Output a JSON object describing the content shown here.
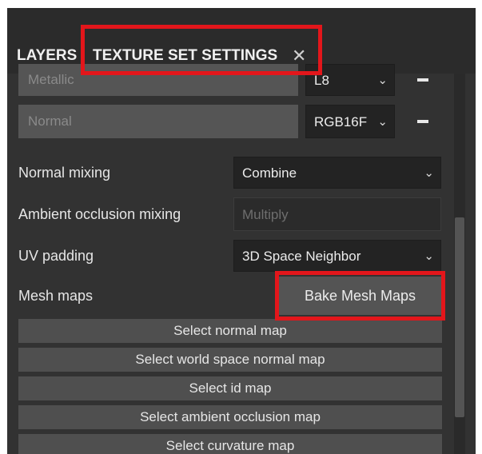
{
  "tabs": {
    "layers": "LAYERS",
    "texture_set_settings": "TEXTURE SET SETTINGS",
    "close": "✕"
  },
  "channels": [
    {
      "name": "Metallic",
      "format": "L8"
    },
    {
      "name": "Normal",
      "format": "RGB16F"
    }
  ],
  "settings": {
    "normal_mixing": {
      "label": "Normal mixing",
      "value": "Combine"
    },
    "ao_mixing": {
      "label": "Ambient occlusion mixing",
      "value": "Multiply"
    },
    "uv_padding": {
      "label": "UV padding",
      "value": "3D Space Neighbor"
    },
    "mesh_maps": {
      "label": "Mesh maps",
      "button": "Bake Mesh Maps"
    }
  },
  "map_buttons": [
    "Select normal map",
    "Select world space normal map",
    "Select id map",
    "Select ambient occlusion map",
    "Select curvature map"
  ],
  "colors": {
    "panel": "#323232",
    "highlight": "#e3161b",
    "disabled_field": "#555555",
    "button": "#4f4f4f"
  },
  "icons": {
    "chevron": "chevron-down-icon",
    "remove": "minus-icon",
    "close": "close-icon"
  }
}
